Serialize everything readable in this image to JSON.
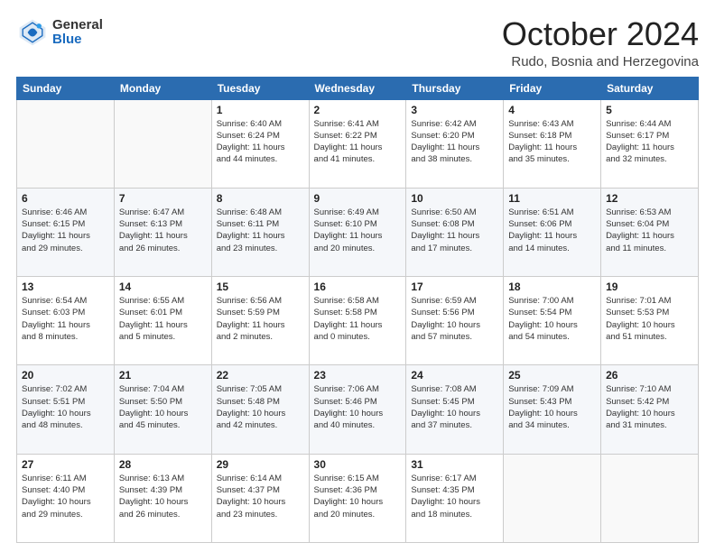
{
  "header": {
    "logo_general": "General",
    "logo_blue": "Blue",
    "month_title": "October 2024",
    "location": "Rudo, Bosnia and Herzegovina"
  },
  "days_of_week": [
    "Sunday",
    "Monday",
    "Tuesday",
    "Wednesday",
    "Thursday",
    "Friday",
    "Saturday"
  ],
  "weeks": [
    [
      {
        "day": "",
        "lines": []
      },
      {
        "day": "",
        "lines": []
      },
      {
        "day": "1",
        "lines": [
          "Sunrise: 6:40 AM",
          "Sunset: 6:24 PM",
          "Daylight: 11 hours",
          "and 44 minutes."
        ]
      },
      {
        "day": "2",
        "lines": [
          "Sunrise: 6:41 AM",
          "Sunset: 6:22 PM",
          "Daylight: 11 hours",
          "and 41 minutes."
        ]
      },
      {
        "day": "3",
        "lines": [
          "Sunrise: 6:42 AM",
          "Sunset: 6:20 PM",
          "Daylight: 11 hours",
          "and 38 minutes."
        ]
      },
      {
        "day": "4",
        "lines": [
          "Sunrise: 6:43 AM",
          "Sunset: 6:18 PM",
          "Daylight: 11 hours",
          "and 35 minutes."
        ]
      },
      {
        "day": "5",
        "lines": [
          "Sunrise: 6:44 AM",
          "Sunset: 6:17 PM",
          "Daylight: 11 hours",
          "and 32 minutes."
        ]
      }
    ],
    [
      {
        "day": "6",
        "lines": [
          "Sunrise: 6:46 AM",
          "Sunset: 6:15 PM",
          "Daylight: 11 hours",
          "and 29 minutes."
        ]
      },
      {
        "day": "7",
        "lines": [
          "Sunrise: 6:47 AM",
          "Sunset: 6:13 PM",
          "Daylight: 11 hours",
          "and 26 minutes."
        ]
      },
      {
        "day": "8",
        "lines": [
          "Sunrise: 6:48 AM",
          "Sunset: 6:11 PM",
          "Daylight: 11 hours",
          "and 23 minutes."
        ]
      },
      {
        "day": "9",
        "lines": [
          "Sunrise: 6:49 AM",
          "Sunset: 6:10 PM",
          "Daylight: 11 hours",
          "and 20 minutes."
        ]
      },
      {
        "day": "10",
        "lines": [
          "Sunrise: 6:50 AM",
          "Sunset: 6:08 PM",
          "Daylight: 11 hours",
          "and 17 minutes."
        ]
      },
      {
        "day": "11",
        "lines": [
          "Sunrise: 6:51 AM",
          "Sunset: 6:06 PM",
          "Daylight: 11 hours",
          "and 14 minutes."
        ]
      },
      {
        "day": "12",
        "lines": [
          "Sunrise: 6:53 AM",
          "Sunset: 6:04 PM",
          "Daylight: 11 hours",
          "and 11 minutes."
        ]
      }
    ],
    [
      {
        "day": "13",
        "lines": [
          "Sunrise: 6:54 AM",
          "Sunset: 6:03 PM",
          "Daylight: 11 hours",
          "and 8 minutes."
        ]
      },
      {
        "day": "14",
        "lines": [
          "Sunrise: 6:55 AM",
          "Sunset: 6:01 PM",
          "Daylight: 11 hours",
          "and 5 minutes."
        ]
      },
      {
        "day": "15",
        "lines": [
          "Sunrise: 6:56 AM",
          "Sunset: 5:59 PM",
          "Daylight: 11 hours",
          "and 2 minutes."
        ]
      },
      {
        "day": "16",
        "lines": [
          "Sunrise: 6:58 AM",
          "Sunset: 5:58 PM",
          "Daylight: 11 hours",
          "and 0 minutes."
        ]
      },
      {
        "day": "17",
        "lines": [
          "Sunrise: 6:59 AM",
          "Sunset: 5:56 PM",
          "Daylight: 10 hours",
          "and 57 minutes."
        ]
      },
      {
        "day": "18",
        "lines": [
          "Sunrise: 7:00 AM",
          "Sunset: 5:54 PM",
          "Daylight: 10 hours",
          "and 54 minutes."
        ]
      },
      {
        "day": "19",
        "lines": [
          "Sunrise: 7:01 AM",
          "Sunset: 5:53 PM",
          "Daylight: 10 hours",
          "and 51 minutes."
        ]
      }
    ],
    [
      {
        "day": "20",
        "lines": [
          "Sunrise: 7:02 AM",
          "Sunset: 5:51 PM",
          "Daylight: 10 hours",
          "and 48 minutes."
        ]
      },
      {
        "day": "21",
        "lines": [
          "Sunrise: 7:04 AM",
          "Sunset: 5:50 PM",
          "Daylight: 10 hours",
          "and 45 minutes."
        ]
      },
      {
        "day": "22",
        "lines": [
          "Sunrise: 7:05 AM",
          "Sunset: 5:48 PM",
          "Daylight: 10 hours",
          "and 42 minutes."
        ]
      },
      {
        "day": "23",
        "lines": [
          "Sunrise: 7:06 AM",
          "Sunset: 5:46 PM",
          "Daylight: 10 hours",
          "and 40 minutes."
        ]
      },
      {
        "day": "24",
        "lines": [
          "Sunrise: 7:08 AM",
          "Sunset: 5:45 PM",
          "Daylight: 10 hours",
          "and 37 minutes."
        ]
      },
      {
        "day": "25",
        "lines": [
          "Sunrise: 7:09 AM",
          "Sunset: 5:43 PM",
          "Daylight: 10 hours",
          "and 34 minutes."
        ]
      },
      {
        "day": "26",
        "lines": [
          "Sunrise: 7:10 AM",
          "Sunset: 5:42 PM",
          "Daylight: 10 hours",
          "and 31 minutes."
        ]
      }
    ],
    [
      {
        "day": "27",
        "lines": [
          "Sunrise: 6:11 AM",
          "Sunset: 4:40 PM",
          "Daylight: 10 hours",
          "and 29 minutes."
        ]
      },
      {
        "day": "28",
        "lines": [
          "Sunrise: 6:13 AM",
          "Sunset: 4:39 PM",
          "Daylight: 10 hours",
          "and 26 minutes."
        ]
      },
      {
        "day": "29",
        "lines": [
          "Sunrise: 6:14 AM",
          "Sunset: 4:37 PM",
          "Daylight: 10 hours",
          "and 23 minutes."
        ]
      },
      {
        "day": "30",
        "lines": [
          "Sunrise: 6:15 AM",
          "Sunset: 4:36 PM",
          "Daylight: 10 hours",
          "and 20 minutes."
        ]
      },
      {
        "day": "31",
        "lines": [
          "Sunrise: 6:17 AM",
          "Sunset: 4:35 PM",
          "Daylight: 10 hours",
          "and 18 minutes."
        ]
      },
      {
        "day": "",
        "lines": []
      },
      {
        "day": "",
        "lines": []
      }
    ]
  ]
}
